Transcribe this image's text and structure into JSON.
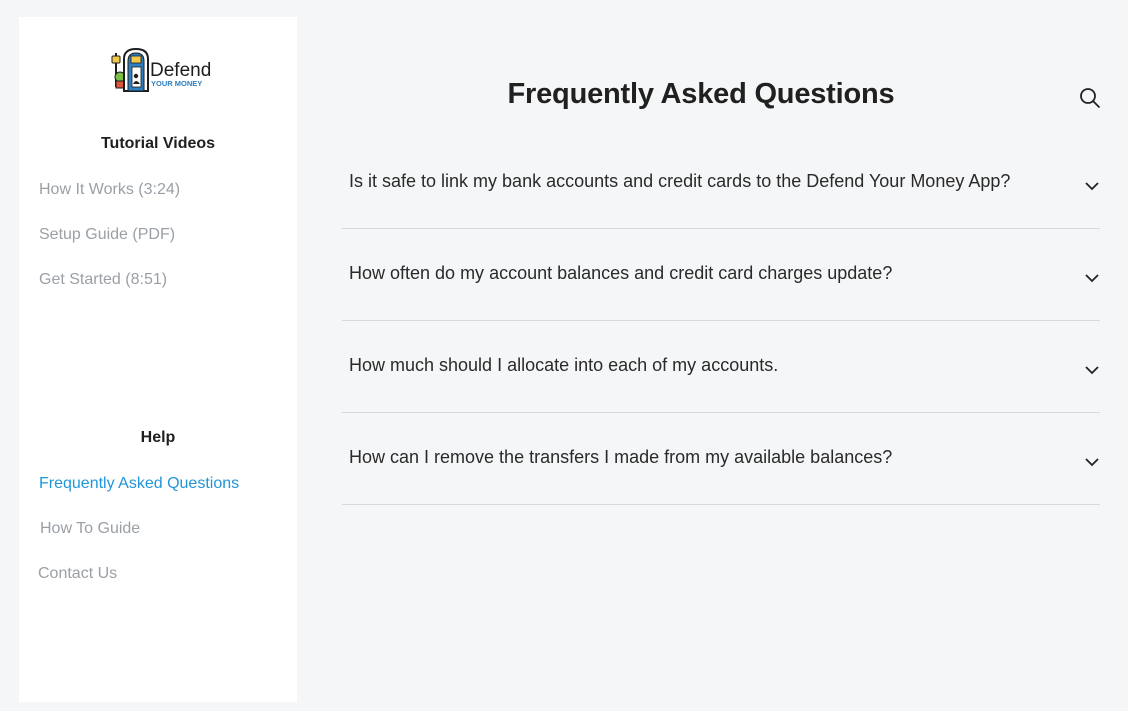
{
  "sidebar": {
    "logo": {
      "text": "Defend",
      "subtext": "YOUR MONEY",
      "icon": "door-logo-icon"
    },
    "tutorials": {
      "title": "Tutorial Videos",
      "items": [
        {
          "label": "How It Works (3:24)"
        },
        {
          "label": "Setup Guide (PDF)"
        },
        {
          "label": "Get Started (8:51)"
        }
      ]
    },
    "help": {
      "title": "Help",
      "items": [
        {
          "label": "Frequently Asked Questions",
          "active": true
        },
        {
          "label": "How To Guide"
        },
        {
          "label": "Contact Us"
        }
      ]
    }
  },
  "main": {
    "title": "Frequently Asked Questions",
    "search_icon": "search-icon",
    "faqs": [
      {
        "question": "Is it safe to link my bank accounts and credit cards to the Defend Your Money App?"
      },
      {
        "question": "How often do my account balances and credit card charges update?"
      },
      {
        "question": "How much should I allocate into each of my accounts."
      },
      {
        "question": "How can I remove the transfers I made from my available balances?"
      }
    ]
  },
  "colors": {
    "accent": "#2196d9",
    "nav_inactive": "#9aa0a6",
    "background": "#f5f6f7",
    "sidebar_bg": "#ffffff",
    "divider": "#d7d9db"
  }
}
